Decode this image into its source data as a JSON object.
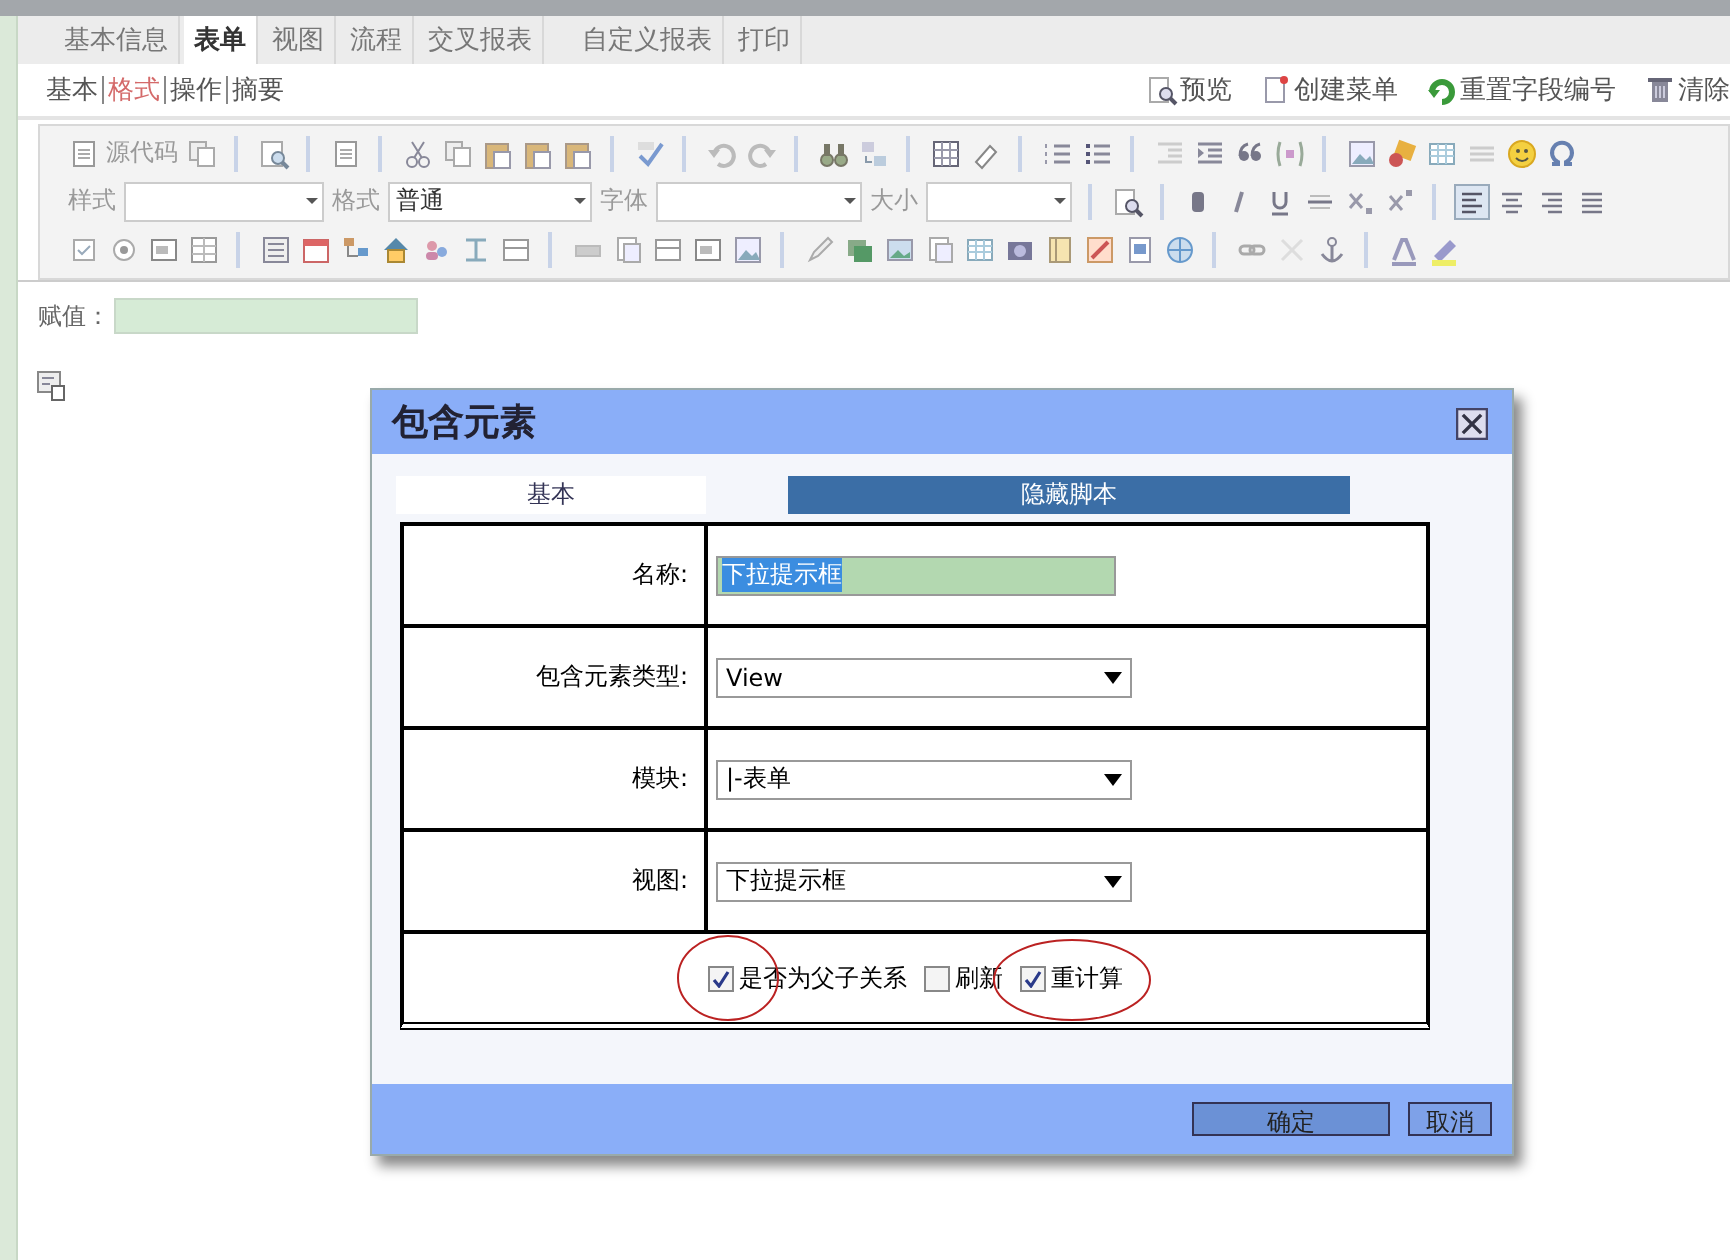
{
  "tabs": [
    {
      "label": "基本信息",
      "selected": false
    },
    {
      "label": "表单",
      "selected": true
    },
    {
      "label": "视图",
      "selected": false
    },
    {
      "label": "流程",
      "selected": false
    },
    {
      "label": "交叉报表",
      "selected": false
    },
    {
      "label": "自定义报表",
      "selected": false
    },
    {
      "label": "打印",
      "selected": false
    }
  ],
  "subtabs": [
    {
      "label": "基本",
      "selected": false
    },
    {
      "label": "格式",
      "selected": true
    },
    {
      "label": "操作",
      "selected": false
    },
    {
      "label": "摘要",
      "selected": false
    }
  ],
  "actions": [
    {
      "label": "预览"
    },
    {
      "label": "创建菜单"
    },
    {
      "label": "重置字段编号"
    },
    {
      "label": "清除"
    }
  ],
  "toolbar": {
    "source_button": "源代码",
    "style_label": "样式",
    "format_label": "格式",
    "format_value": "普通",
    "font_label": "字体",
    "size_label": "大小"
  },
  "field": {
    "label": "赋值："
  },
  "dialog": {
    "title": "包含元素",
    "tabs": [
      {
        "label": "基本",
        "selected": true
      },
      {
        "label": "隐藏脚本",
        "selected": false
      }
    ],
    "rows": [
      {
        "label": "名称:",
        "kind": "text",
        "value": "下拉提示框"
      },
      {
        "label": "包含元素类型:",
        "kind": "select",
        "value": "View"
      },
      {
        "label": "模块:",
        "kind": "select",
        "value": "|-表单"
      },
      {
        "label": "视图:",
        "kind": "select",
        "value": "下拉提示框"
      }
    ],
    "options": [
      {
        "label": "是否为父子关系",
        "checked": true,
        "circled": true
      },
      {
        "label": "刷新",
        "checked": false
      },
      {
        "label": "重计算",
        "checked": true,
        "circled": true
      }
    ],
    "buttons": [
      {
        "label": "确定",
        "kind": "primary"
      },
      {
        "label": "取消",
        "kind": "secondary"
      }
    ]
  }
}
